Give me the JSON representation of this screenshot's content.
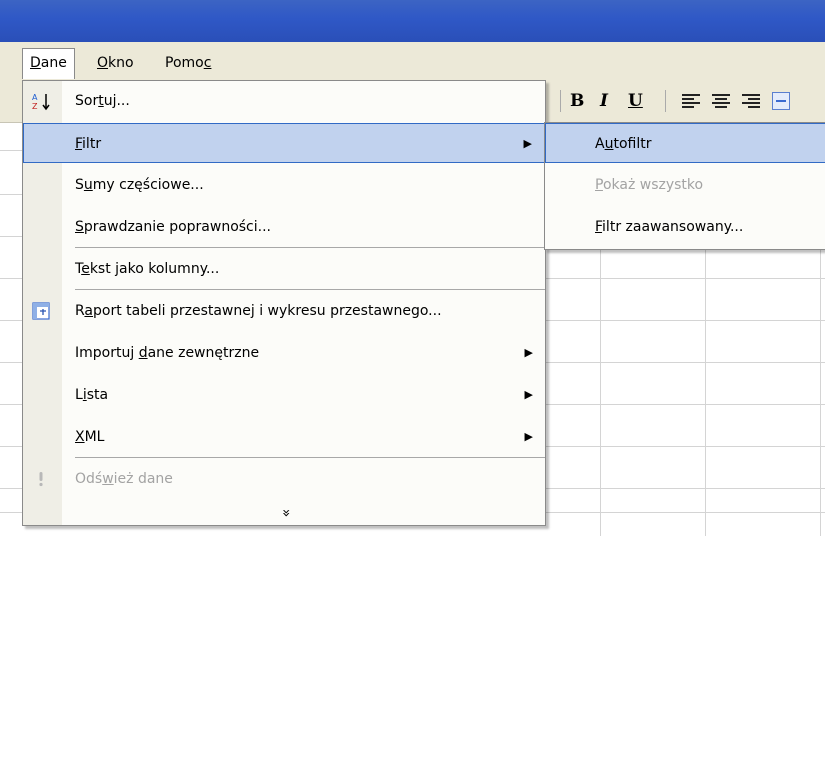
{
  "menubar": {
    "items": [
      {
        "label": "Dane",
        "accel": "D",
        "rest": "ane"
      },
      {
        "label": "Okno",
        "accel": "O",
        "rest": "kno"
      },
      {
        "label": "Pomoc",
        "pre": "Pomo",
        "accel": "c"
      }
    ]
  },
  "toolbar": {
    "bold": "B",
    "italic": "I",
    "underline": "U"
  },
  "dane_menu": {
    "items": [
      {
        "label": "Sortuj...",
        "pre": "Sor",
        "accel": "t",
        "rest": "uj..."
      },
      {
        "label": "Filtr",
        "pre": "",
        "accel": "F",
        "rest": "iltr"
      },
      {
        "label": "Sumy częściowe...",
        "pre": "S",
        "accel": "u",
        "rest": "my częściowe..."
      },
      {
        "label": "Sprawdzanie poprawności...",
        "pre": "",
        "accel": "S",
        "rest": "prawdzanie poprawności..."
      },
      {
        "label": "Tekst jako kolumny...",
        "pre": "T",
        "accel": "e",
        "rest": "kst jako kolumny..."
      },
      {
        "label": "Raport tabeli przestawnej i wykresu przestawnego...",
        "pre": "R",
        "accel": "a",
        "rest": "port tabeli przestawnej i wykresu przestawnego..."
      },
      {
        "label": "Importuj dane zewnętrzne",
        "pre": "Importuj ",
        "accel": "d",
        "rest": "ane zewnętrzne"
      },
      {
        "label": "Lista",
        "pre": "L",
        "accel": "i",
        "rest": "sta"
      },
      {
        "label": "XML",
        "pre": "",
        "accel": "X",
        "rest": "ML"
      },
      {
        "label": "Odśwież dane",
        "pre": "Odś",
        "accel": "w",
        "rest": "ież dane"
      }
    ],
    "expand": "»"
  },
  "filtr_submenu": {
    "items": [
      {
        "label": "Autofiltr",
        "pre": "A",
        "accel": "u",
        "rest": "tofiltr"
      },
      {
        "label": "Pokaż wszystko",
        "pre": "",
        "accel": "P",
        "rest": "okaż wszystko"
      },
      {
        "label": "Filtr zaawansowany...",
        "pre": "",
        "accel": "F",
        "rest": "iltr zaawansowany..."
      }
    ]
  },
  "colors": {
    "title": "#2f58c6",
    "menubar": "#ece9d8",
    "highlight": "#c1d2ee",
    "highlight_border": "#316ac5",
    "disabled": "#a3a3a3"
  }
}
